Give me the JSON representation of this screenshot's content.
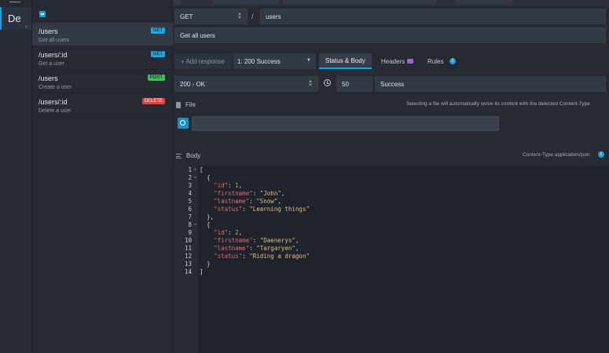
{
  "environment": {
    "abbrev": "De"
  },
  "routes": [
    {
      "path": "/users",
      "description": "Get all users",
      "method": "GET",
      "active": true
    },
    {
      "path": "/users/:id",
      "description": "Get a user",
      "method": "GET",
      "active": false
    },
    {
      "path": "/users",
      "description": "Create a user",
      "method": "POST",
      "active": false
    },
    {
      "path": "/users/:id",
      "description": "Delete a user",
      "method": "DELETE",
      "active": false
    }
  ],
  "route_editor": {
    "method": "GET",
    "separator": "/",
    "path": "users",
    "documentation": "Get all users"
  },
  "response_bar": {
    "add_response_label": "+ Add response",
    "selected_response": "1: 200  Success",
    "tabs": [
      "Status & Body",
      "Headers",
      "Rules"
    ]
  },
  "status_row": {
    "status_code": "200 - OK",
    "latency": "50",
    "label": "Success"
  },
  "file_section": {
    "title": "File",
    "hint": "Selecting a file will automatically serve its content with the detected Content-Type",
    "file_path": ""
  },
  "body_section": {
    "title": "Body",
    "content_type": "Content-Type application/json"
  },
  "body_lines": [
    [
      [
        "punc",
        "["
      ]
    ],
    [
      [
        "punc",
        "  {"
      ]
    ],
    [
      [
        "punc",
        "    "
      ],
      [
        "key",
        "\"id\""
      ],
      [
        "punc",
        ": "
      ],
      [
        "num",
        "1"
      ],
      [
        "punc",
        ","
      ]
    ],
    [
      [
        "punc",
        "    "
      ],
      [
        "key",
        "\"firstname\""
      ],
      [
        "punc",
        ": "
      ],
      [
        "str",
        "\"John\""
      ],
      [
        "punc",
        ","
      ]
    ],
    [
      [
        "punc",
        "    "
      ],
      [
        "key",
        "\"lastname\""
      ],
      [
        "punc",
        ": "
      ],
      [
        "str",
        "\"Snow\""
      ],
      [
        "punc",
        ","
      ]
    ],
    [
      [
        "punc",
        "    "
      ],
      [
        "key",
        "\"status\""
      ],
      [
        "punc",
        ": "
      ],
      [
        "str",
        "\"Learning things\""
      ]
    ],
    [
      [
        "punc",
        "  },"
      ]
    ],
    [
      [
        "punc",
        "  {"
      ]
    ],
    [
      [
        "punc",
        "    "
      ],
      [
        "key",
        "\"id\""
      ],
      [
        "punc",
        ": "
      ],
      [
        "num",
        "2"
      ],
      [
        "punc",
        ","
      ]
    ],
    [
      [
        "punc",
        "    "
      ],
      [
        "key",
        "\"firstname\""
      ],
      [
        "punc",
        ": "
      ],
      [
        "str",
        "\"Daenerys\""
      ],
      [
        "punc",
        ","
      ]
    ],
    [
      [
        "punc",
        "    "
      ],
      [
        "key",
        "\"lastname\""
      ],
      [
        "punc",
        ": "
      ],
      [
        "str",
        "\"Targaryen\""
      ],
      [
        "punc",
        ","
      ]
    ],
    [
      [
        "punc",
        "    "
      ],
      [
        "key",
        "\"status\""
      ],
      [
        "punc",
        ": "
      ],
      [
        "str",
        "\"Riding a dragon\""
      ]
    ],
    [
      [
        "punc",
        "  }"
      ]
    ],
    [
      [
        "punc",
        "]"
      ]
    ]
  ],
  "folded_lines": [
    1,
    2,
    8
  ],
  "colors": {
    "accent": "#1da1dc",
    "get": "#1ea7e4",
    "post": "#3fbf5a",
    "delete": "#e53f3f",
    "headers_badge": "#a55fd6"
  }
}
